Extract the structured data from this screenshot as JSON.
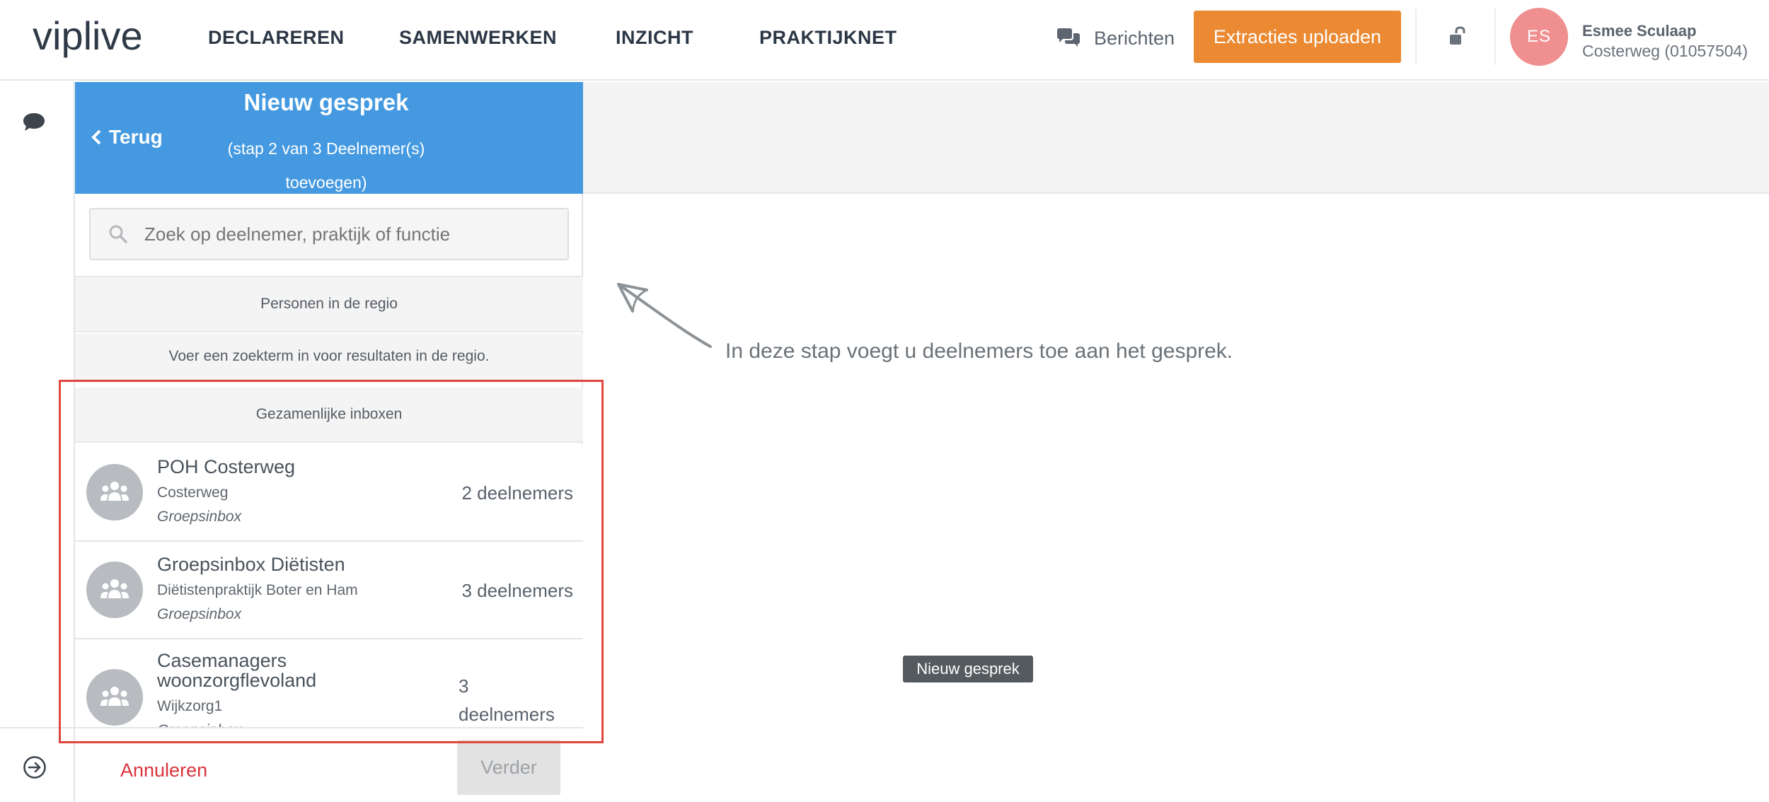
{
  "header": {
    "logo": "viplive",
    "nav": [
      "DECLAREREN",
      "SAMENWERKEN",
      "INZICHT",
      "PRAKTIJKNET"
    ],
    "berichten_label": "Berichten",
    "upload_label": "Extracties uploaden",
    "user": {
      "initials": "ES",
      "name": "Esmee Sculaap",
      "practice": "Costerweg (01057504)"
    }
  },
  "panel": {
    "back_label": "Terug",
    "title": "Nieuw gesprek",
    "subtitle_line1": "(stap 2 van 3 Deelnemer(s)",
    "subtitle_line2": "toevoegen)",
    "search_placeholder": "Zoek op deelnemer, praktijk of functie",
    "section_persons": "Personen in de regio",
    "persons_hint": "Voer een zoekterm in voor resultaten in de regio.",
    "section_inboxes": "Gezamenlijke inboxen",
    "inboxes": [
      {
        "title": "POH Costerweg",
        "sub": "Costerweg",
        "type": "Groepsinbox",
        "count": "2 deelnemers"
      },
      {
        "title": "Groepsinbox Diëtisten",
        "sub": "Diëtistenpraktijk Boter en Ham",
        "type": "Groepsinbox",
        "count": "3 deelnemers"
      },
      {
        "title": "Casemanagers woonzorgflevoland",
        "sub": "Wijkzorg1",
        "type": "Groepsinbox",
        "count_line1": "3",
        "count_line2": "deelnemers"
      }
    ],
    "cancel_label": "Annuleren",
    "next_label": "Verder"
  },
  "main": {
    "hint": "In deze stap voegt u deelnemers toe aan het gesprek.",
    "tooltip": "Nieuw gesprek"
  },
  "colors": {
    "brand_blue": "#4499e0",
    "accent_orange": "#eb8a33",
    "cancel_red": "#d9333b",
    "highlight_red": "#e0463d",
    "avatar_pink": "#ef8f8f"
  },
  "icons": [
    "chat-bubbles-icon",
    "unlock-icon",
    "chat-icon",
    "exit-arrow-icon",
    "search-icon",
    "group-icon",
    "chevron-left-icon",
    "curved-arrow-icon"
  ]
}
